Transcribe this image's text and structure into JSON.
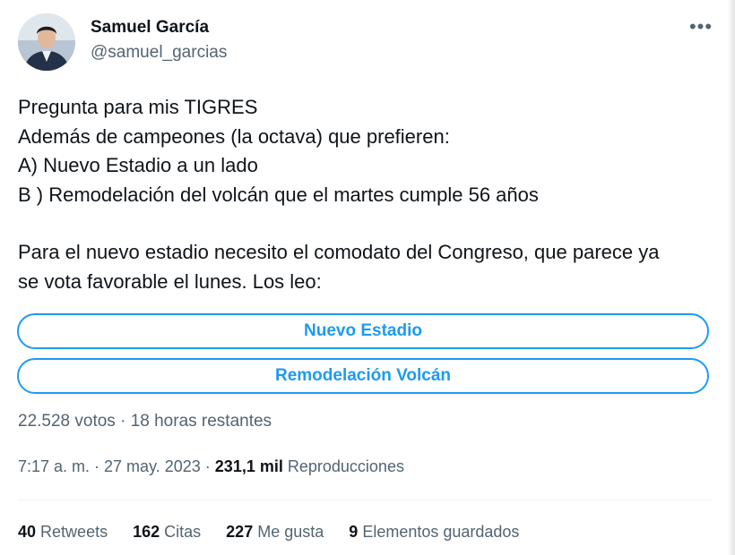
{
  "author": {
    "name": "Samuel García",
    "handle": "@samuel_garcias"
  },
  "more_icon": "more-horizontal-icon",
  "tweet": {
    "lines": [
      "Pregunta para mis TIGRES",
      "Además de campeones (la octava) que prefieren:",
      "A) Nuevo Estadio a un lado",
      "B ) Remodelación del volcán que el martes cumple 56 años",
      "Para el nuevo estadio necesito el comodato del Congreso, que parece ya",
      "se vota favorable el lunes. Los leo:"
    ]
  },
  "poll": {
    "options": [
      "Nuevo Estadio",
      "Remodelación Volcán"
    ],
    "meta": "22.528 votos · 18 horas restantes"
  },
  "timestamp": {
    "time_date": "7:17 a. m. · 27 may. 2023 ·",
    "views_count": "231,1 mil",
    "views_label": "Reproducciones"
  },
  "stats": {
    "retweets": {
      "count": "40",
      "label": "Retweets"
    },
    "quotes": {
      "count": "162",
      "label": "Citas"
    },
    "likes": {
      "count": "227",
      "label": "Me gusta"
    },
    "bookmarks": {
      "count": "9",
      "label": "Elementos guardados"
    }
  },
  "colors": {
    "accent": "#1d9bf0",
    "secondary_text": "#536471",
    "primary_text": "#0f1419"
  }
}
